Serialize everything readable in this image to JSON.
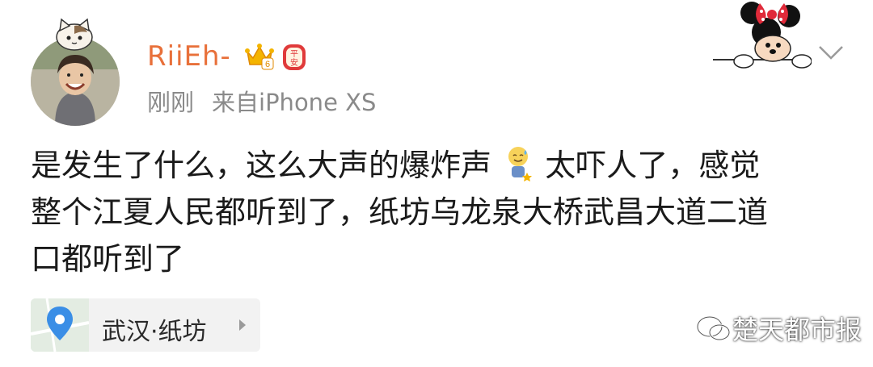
{
  "post": {
    "author": {
      "username": "RiiEh-",
      "level_badge": "6",
      "ping_an_badge": [
        "平",
        "安"
      ]
    },
    "timestamp": "刚刚",
    "source": "来自iPhone XS",
    "text": {
      "line1_a": "是发生了什么，这么大声的爆炸声",
      "line1_b": "太吓人了，感觉",
      "line2": "整个江夏人民都听到了，纸坊乌龙泉大桥武昌大道二道",
      "line3": "口都听到了"
    },
    "location": {
      "label": "武汉·纸坊"
    }
  },
  "watermark": {
    "text": "楚天都市报"
  },
  "icons": {
    "location": "map-pin-icon",
    "more": "chevron-down-icon",
    "emoji": "sweat-smile-emoji",
    "wechat": "wechat-icon"
  },
  "colors": {
    "username": "#e8703a",
    "meta": "#8a8a8a",
    "pin": "#3a8ee6",
    "badge_red": "#e03a3a",
    "badge_gold": "#f4b400"
  }
}
